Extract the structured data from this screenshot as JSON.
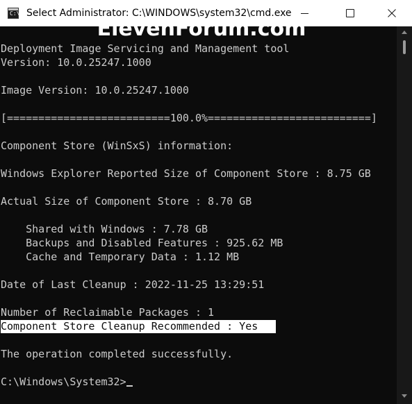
{
  "window": {
    "title": "Select Administrator: C:\\WINDOWS\\system32\\cmd.exe",
    "icon": "cmd-app-icon",
    "icon_glyph": "C:\\",
    "caption_buttons": {
      "minimize_icon": "minimize-icon",
      "maximize_icon": "maximize-icon",
      "close_icon": "close-icon"
    }
  },
  "watermark": {
    "text": "ElevenForum.com"
  },
  "console": {
    "lines": [
      "Deployment Image Servicing and Management tool",
      "Version: 10.0.25247.1000",
      "",
      "Image Version: 10.0.25247.1000",
      "",
      "[==========================100.0%==========================]",
      "",
      "Component Store (WinSxS) information:",
      "",
      "Windows Explorer Reported Size of Component Store : 8.75 GB",
      "",
      "Actual Size of Component Store : 8.70 GB",
      "",
      "    Shared with Windows : 7.78 GB",
      "    Backups and Disabled Features : 925.62 MB",
      "    Cache and Temporary Data : 1.12 MB",
      "",
      "Date of Last Cleanup : 2022-11-25 13:29:51",
      "",
      "Number of Reclaimable Packages : 1",
      "Component Store Cleanup Recommended : Yes",
      "",
      "The operation completed successfully.",
      "",
      "C:\\Windows\\System32>"
    ],
    "highlighted_line_index": 20
  },
  "colors": {
    "console_background": "#0c0c0c",
    "console_text": "#cccccc",
    "titlebar_background": "#ffffff",
    "selection_background": "#ffffff",
    "selection_text": "#0c0c0c"
  }
}
